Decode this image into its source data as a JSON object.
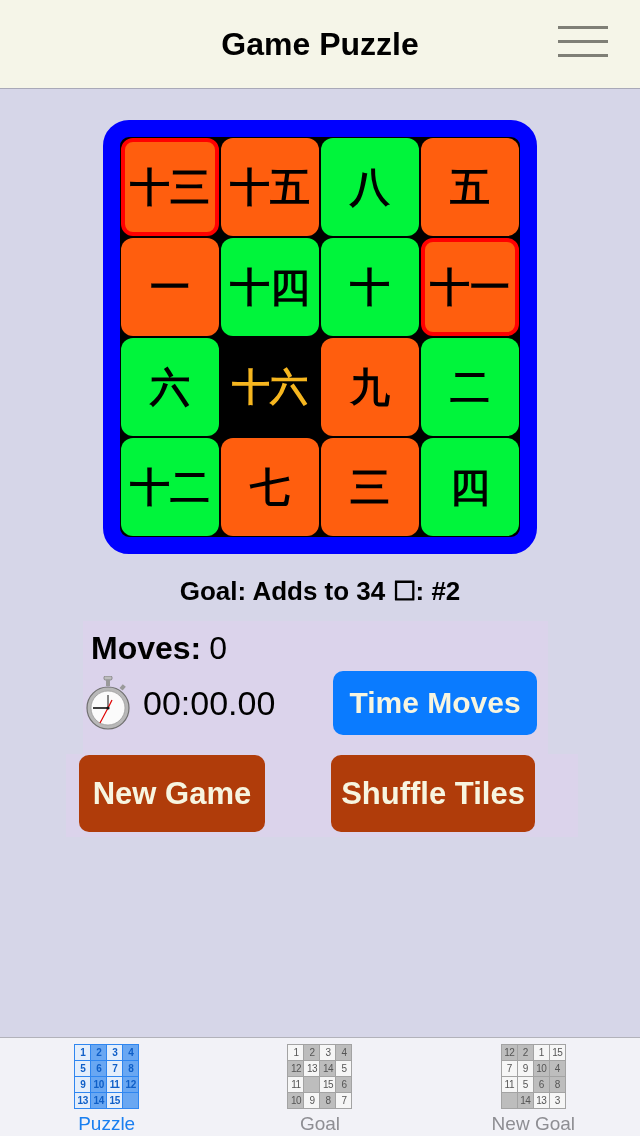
{
  "nav_bar": {
    "title": "Game Puzzle"
  },
  "board": {
    "tiles": [
      {
        "kind": "tile",
        "label": "十三",
        "color": "#ff5e0e",
        "selected": true
      },
      {
        "kind": "tile",
        "label": "十五",
        "color": "#ff5e0e",
        "selected": false
      },
      {
        "kind": "tile",
        "label": "八",
        "color": "#00f53b",
        "selected": false
      },
      {
        "kind": "tile",
        "label": "五",
        "color": "#ff5e0e",
        "selected": false
      },
      {
        "kind": "tile",
        "label": "一",
        "color": "#ff5e0e",
        "selected": false
      },
      {
        "kind": "tile",
        "label": "十四",
        "color": "#00f53b",
        "selected": false
      },
      {
        "kind": "tile",
        "label": "十",
        "color": "#00f53b",
        "selected": false
      },
      {
        "kind": "tile",
        "label": "十一",
        "color": "#ff5e0e",
        "selected": true
      },
      {
        "kind": "tile",
        "label": "六",
        "color": "#00f53b",
        "selected": false
      },
      {
        "kind": "empty",
        "label": "十六"
      },
      {
        "kind": "tile",
        "label": "九",
        "color": "#ff5e0e",
        "selected": false
      },
      {
        "kind": "tile",
        "label": "二",
        "color": "#00f53b",
        "selected": false
      },
      {
        "kind": "tile",
        "label": "十二",
        "color": "#00f53b",
        "selected": false
      },
      {
        "kind": "tile",
        "label": "七",
        "color": "#ff5e0e",
        "selected": false
      },
      {
        "kind": "tile",
        "label": "三",
        "color": "#ff5e0e",
        "selected": false
      },
      {
        "kind": "tile",
        "label": "四",
        "color": "#00f53b",
        "selected": false
      }
    ]
  },
  "goal": {
    "text": "Goal: Adds to 34 ☐: #2"
  },
  "moves": {
    "label": "Moves:",
    "value": "0"
  },
  "timer": {
    "value": "00:00.00",
    "button": "Time Moves"
  },
  "actions": [
    {
      "label": "New Game"
    },
    {
      "label": "Shuffle Tiles"
    }
  ],
  "tab_bar": {
    "tabs": [
      {
        "label": "Puzzle",
        "selected": true,
        "icon_cells": [
          {
            "label": "1",
            "shaded": false
          },
          {
            "label": "2",
            "shaded": true
          },
          {
            "label": "3",
            "shaded": false
          },
          {
            "label": "4",
            "shaded": true
          },
          {
            "label": "5",
            "shaded": false
          },
          {
            "label": "6",
            "shaded": true
          },
          {
            "label": "7",
            "shaded": false
          },
          {
            "label": "8",
            "shaded": true
          },
          {
            "label": "9",
            "shaded": false
          },
          {
            "label": "10",
            "shaded": true
          },
          {
            "label": "11",
            "shaded": false
          },
          {
            "label": "12",
            "shaded": true
          },
          {
            "label": "13",
            "shaded": false
          },
          {
            "label": "14",
            "shaded": true
          },
          {
            "label": "15",
            "shaded": false
          },
          {
            "shaded": true
          }
        ]
      },
      {
        "label": "Goal",
        "selected": false,
        "icon_cells": [
          {
            "label": "1",
            "shaded": false
          },
          {
            "label": "2",
            "shaded": true
          },
          {
            "label": "3",
            "shaded": false
          },
          {
            "label": "4",
            "shaded": true
          },
          {
            "label": "12",
            "shaded": true
          },
          {
            "label": "13",
            "shaded": false
          },
          {
            "label": "14",
            "shaded": true
          },
          {
            "label": "5",
            "shaded": false
          },
          {
            "label": "11",
            "shaded": false
          },
          {
            "shaded": true
          },
          {
            "label": "15",
            "shaded": false
          },
          {
            "label": "6",
            "shaded": true
          },
          {
            "label": "10",
            "shaded": true
          },
          {
            "label": "9",
            "shaded": false
          },
          {
            "label": "8",
            "shaded": true
          },
          {
            "label": "7",
            "shaded": false
          }
        ]
      },
      {
        "label": "New Goal",
        "selected": false,
        "icon_cells": [
          {
            "label": "12",
            "shaded": true
          },
          {
            "label": "2",
            "shaded": true
          },
          {
            "label": "1",
            "shaded": false
          },
          {
            "label": "15",
            "shaded": false
          },
          {
            "label": "7",
            "shaded": false
          },
          {
            "label": "9",
            "shaded": false
          },
          {
            "label": "10",
            "shaded": true
          },
          {
            "label": "4",
            "shaded": true
          },
          {
            "label": "11",
            "shaded": false
          },
          {
            "label": "5",
            "shaded": false
          },
          {
            "label": "6",
            "shaded": true
          },
          {
            "label": "8",
            "shaded": true
          },
          {
            "shaded": true
          },
          {
            "label": "14",
            "shaded": true
          },
          {
            "label": "13",
            "shaded": false
          },
          {
            "label": "3",
            "shaded": false
          }
        ]
      }
    ]
  }
}
